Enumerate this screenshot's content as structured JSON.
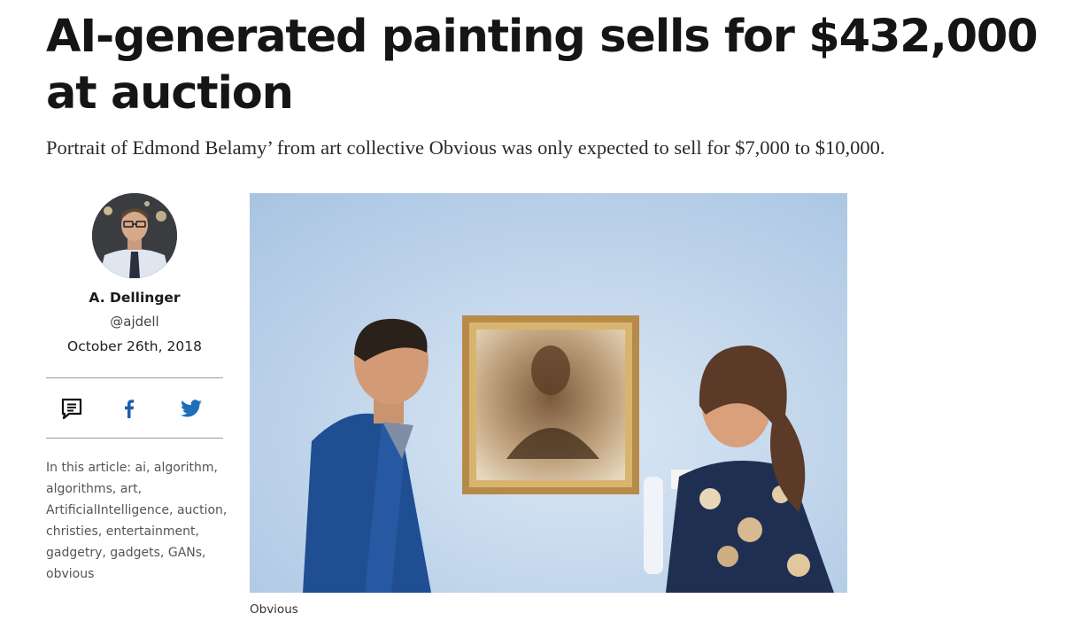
{
  "article": {
    "headline": "AI-generated painting sells for $432,000 at auction",
    "dek": "Portrait of Edmond Belamy’ from art collective Obvious was only expected to sell for $7,000 to $10,000.",
    "image_caption": "Obvious"
  },
  "author": {
    "name": "A. Dellinger",
    "handle": "@ajdell",
    "date": "October 26th, 2018"
  },
  "share": {
    "icons": [
      "comment-icon",
      "facebook-icon",
      "twitter-icon"
    ]
  },
  "tags": {
    "prefix": "In this article:",
    "items": [
      "ai",
      "algorithm",
      "algorithms",
      "art",
      "ArtificialIntelligence",
      "auction",
      "christies",
      "entertainment",
      "gadgetry",
      "gadgets",
      "GANs",
      "obvious"
    ]
  },
  "colors": {
    "text": "#151515",
    "muted": "#555555",
    "rule": "#9a9a9a",
    "image_wall": "#b9d0e8"
  }
}
